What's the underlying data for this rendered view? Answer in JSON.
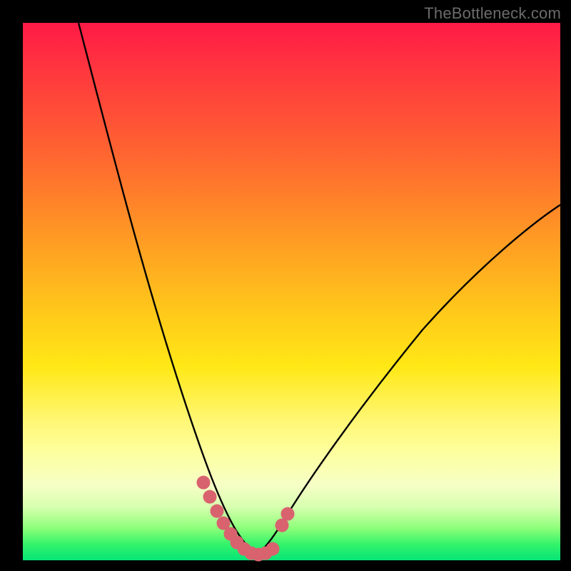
{
  "watermark": {
    "text": "TheBottleneck.com"
  },
  "colors": {
    "curve_stroke": "#000000",
    "marker_fill": "#d9626f",
    "marker_stroke": "#d9626f"
  },
  "chart_data": {
    "type": "line",
    "title": "",
    "xlabel": "",
    "ylabel": "",
    "xlim": [
      0,
      100
    ],
    "ylim": [
      0,
      100
    ],
    "grid": false,
    "legend": false,
    "annotations": [],
    "series": [
      {
        "name": "left-curve",
        "x": [
          10,
          12,
          15,
          18,
          21,
          24,
          27,
          30,
          32,
          34,
          36,
          37.5,
          38.5,
          39.5,
          40.5,
          41.5,
          42.5
        ],
        "y": [
          100,
          90,
          78,
          66,
          56,
          46,
          37,
          28,
          22,
          16,
          11,
          8,
          6,
          4.5,
          3.2,
          2.2,
          1.5
        ]
      },
      {
        "name": "right-curve",
        "x": [
          42.5,
          43.5,
          44.5,
          46,
          48,
          50,
          53,
          57,
          62,
          68,
          74,
          80,
          86,
          92,
          98,
          100
        ],
        "y": [
          1.5,
          2.2,
          3.3,
          5,
          8,
          11,
          15,
          20,
          26,
          33,
          39,
          45,
          51,
          56,
          60,
          62
        ]
      },
      {
        "name": "marker-cluster",
        "x": [
          33.5,
          35.2,
          36.8,
          38.5,
          40.2,
          41.8,
          43.5,
          44.8,
          46.3,
          47.4,
          48.6
        ],
        "y": [
          14.5,
          10.5,
          7.2,
          4.2,
          2.5,
          1.6,
          1.6,
          2.5,
          4.2,
          6.5,
          9.5
        ]
      }
    ]
  }
}
